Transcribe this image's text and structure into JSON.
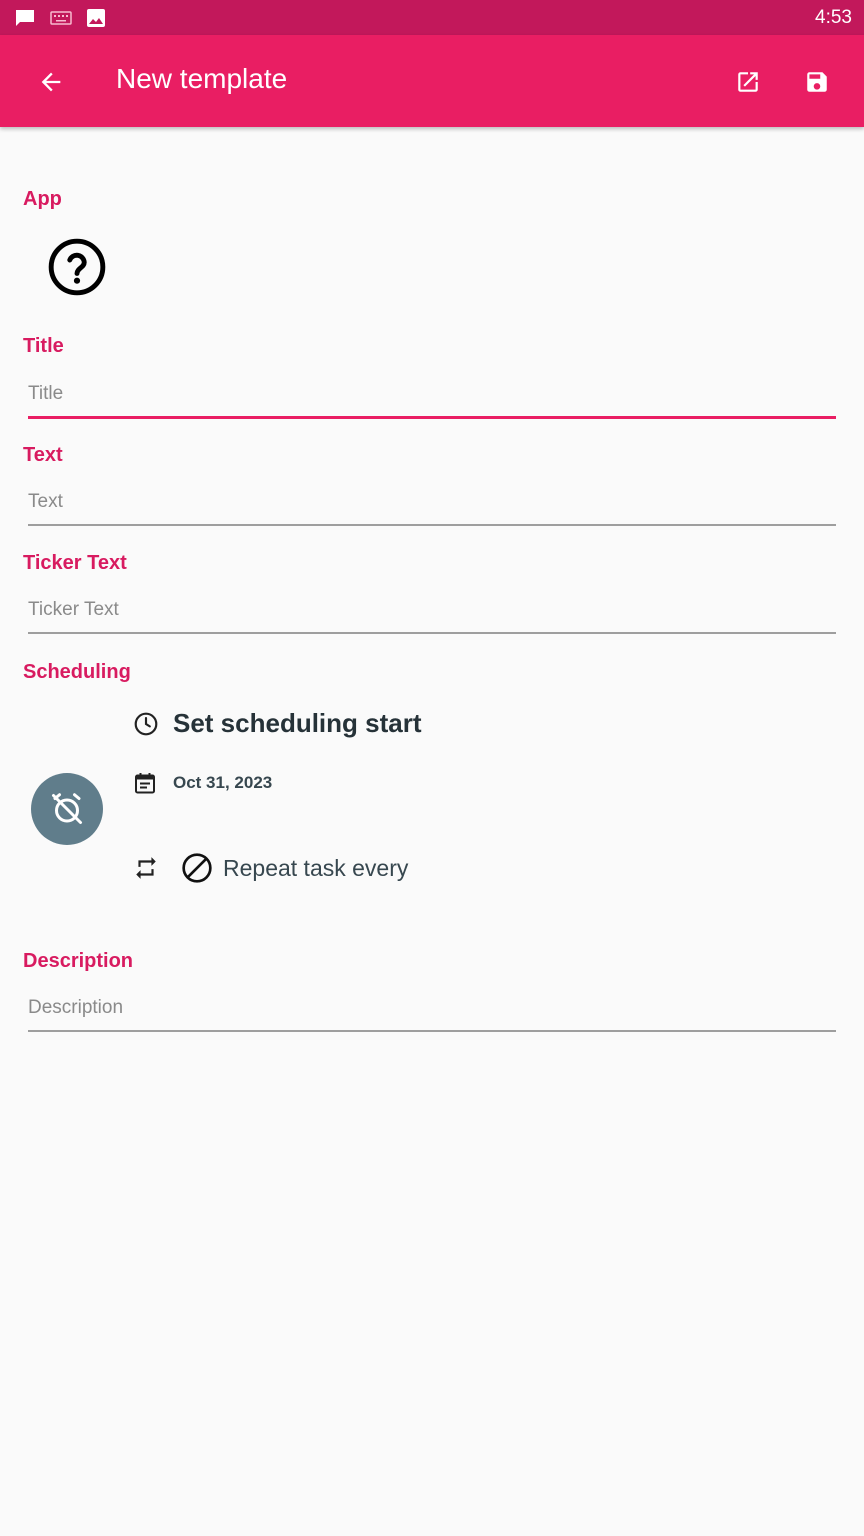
{
  "status_bar": {
    "time": "4:53",
    "icons": [
      "message-icon",
      "keyboard-icon",
      "image-icon"
    ],
    "background": "#c2185b"
  },
  "app_bar": {
    "title": "New template",
    "background": "#e91e63",
    "actions": [
      "open-in-new-icon",
      "save-icon"
    ]
  },
  "sections": {
    "app_label": "App",
    "title_label": "Title",
    "text_label": "Text",
    "ticker_label": "Ticker Text",
    "scheduling_label": "Scheduling",
    "description_label": "Description"
  },
  "fields": {
    "title": {
      "value": "",
      "placeholder": "Title"
    },
    "text": {
      "value": "",
      "placeholder": "Text"
    },
    "ticker": {
      "value": "",
      "placeholder": "Ticker Text"
    },
    "description": {
      "value": "",
      "placeholder": "Description"
    }
  },
  "scheduling": {
    "start_label": "Set scheduling start",
    "date": "Oct 31, 2023",
    "repeat_label": "Repeat task every"
  },
  "colors": {
    "accent": "#e91e63",
    "label": "#d81b60",
    "fab": "#607d8b"
  }
}
